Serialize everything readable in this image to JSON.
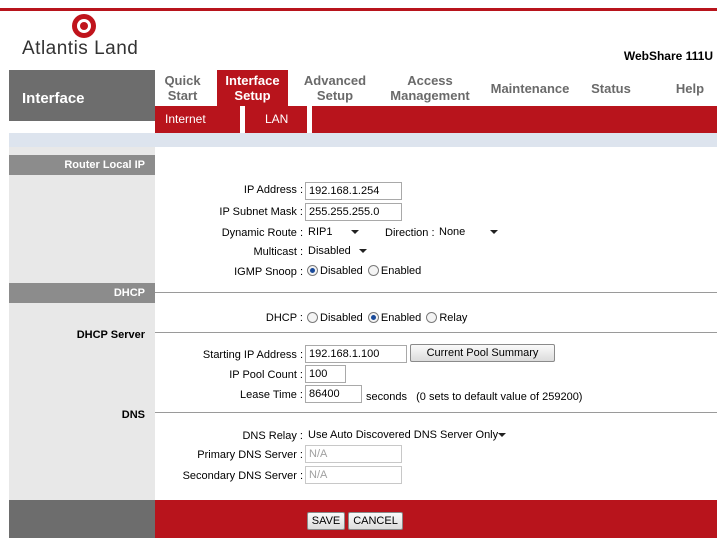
{
  "brand": {
    "logo_text": "Atlantis Land",
    "model": "WebShare 111U"
  },
  "sidebar": {
    "title": "Interface"
  },
  "nav": {
    "items": [
      {
        "label": "Quick\nStart"
      },
      {
        "label": "Interface\nSetup"
      },
      {
        "label": "Advanced\nSetup"
      },
      {
        "label": "Access\nManagement"
      },
      {
        "label": "Maintenance"
      },
      {
        "label": "Status"
      },
      {
        "label": "Help"
      }
    ],
    "subtabs": [
      {
        "label": "Internet"
      },
      {
        "label": "LAN"
      }
    ]
  },
  "sections": {
    "router": "Router Local IP",
    "dhcp": "DHCP",
    "dhcp_server": "DHCP Server",
    "dns": "DNS"
  },
  "router": {
    "ip_label": "IP Address :",
    "ip_value": "192.168.1.254",
    "mask_label": "IP Subnet Mask :",
    "mask_value": "255.255.255.0",
    "route_label": "Dynamic Route :",
    "route_value": "RIP1",
    "direction_label": "Direction :",
    "direction_value": "None",
    "multicast_label": "Multicast :",
    "multicast_value": "Disabled",
    "igmp_label": "IGMP Snoop :",
    "igmp_opt1": "Disabled",
    "igmp_opt2": "Enabled"
  },
  "dhcp": {
    "label": "DHCP :",
    "opt1": "Disabled",
    "opt2": "Enabled",
    "opt3": "Relay",
    "start_label": "Starting IP Address :",
    "start_value": "192.168.1.100",
    "pool_button": "Current Pool Summary",
    "count_label": "IP Pool Count :",
    "count_value": "100",
    "lease_label": "Lease Time :",
    "lease_value": "86400",
    "lease_note": "seconds   (0 sets to default value of 259200)"
  },
  "dns": {
    "relay_label": "DNS Relay :",
    "relay_value": "Use Auto Discovered DNS Server Only",
    "primary_label": "Primary DNS Server :",
    "primary_value": "N/A",
    "secondary_label": "Secondary DNS Server :",
    "secondary_value": "N/A"
  },
  "footer": {
    "save": "SAVE",
    "cancel": "CANCEL"
  },
  "colors": {
    "accent": "#b8141c",
    "side": "#6d6d6d",
    "side_light": "#e8e8e8",
    "strip": "#dde4ee"
  }
}
